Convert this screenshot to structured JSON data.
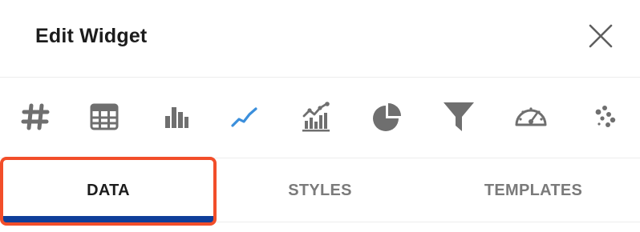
{
  "dialog": {
    "title": "Edit Widget"
  },
  "widget_types": [
    {
      "icon": "hash-icon",
      "selected": false
    },
    {
      "icon": "table-icon",
      "selected": false
    },
    {
      "icon": "bar-chart-icon",
      "selected": false
    },
    {
      "icon": "line-chart-icon",
      "selected": true
    },
    {
      "icon": "combo-chart-icon",
      "selected": false
    },
    {
      "icon": "pie-chart-icon",
      "selected": false
    },
    {
      "icon": "funnel-icon",
      "selected": false
    },
    {
      "icon": "gauge-icon",
      "selected": false
    },
    {
      "icon": "scatter-icon",
      "selected": false
    }
  ],
  "tabs": [
    {
      "label": "DATA",
      "active": true
    },
    {
      "label": "STYLES",
      "active": false
    },
    {
      "label": "TEMPLATES",
      "active": false
    }
  ],
  "colors": {
    "icon": "#6f6f6f",
    "selected_icon": "#3b8fdc",
    "active_tab_underline": "#0f3f9a",
    "highlight": "#f24e2a"
  }
}
